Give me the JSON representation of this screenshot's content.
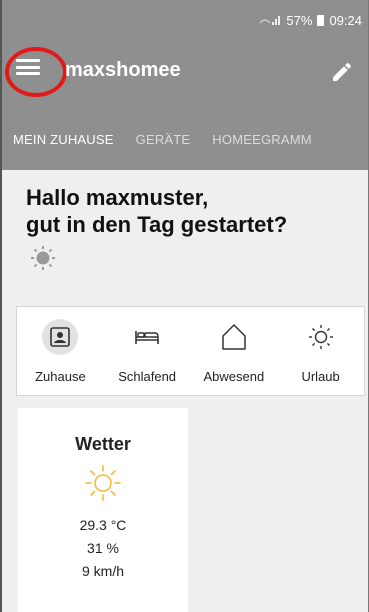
{
  "status_bar": {
    "signal_icons": "⚡ᵢₗ",
    "battery_percent": "57%",
    "time": "09:24"
  },
  "app_bar": {
    "title": "maxshomee",
    "menu_icon": "hamburger-menu-icon",
    "edit_icon": "pencil-icon"
  },
  "tabs": [
    {
      "label": "MEIN ZUHAUSE",
      "active": true
    },
    {
      "label": "GERÄTE",
      "active": false
    },
    {
      "label": "HOMEEGRAMM",
      "active": false
    }
  ],
  "greeting": {
    "line1": "Hallo maxmuster,",
    "line2": "gut in den Tag gestartet?"
  },
  "modes": [
    {
      "label": "Zuhause",
      "icon": "home-person-icon",
      "active": true
    },
    {
      "label": "Schlafend",
      "icon": "bed-icon",
      "active": false
    },
    {
      "label": "Abwesend",
      "icon": "house-outline-icon",
      "active": false
    },
    {
      "label": "Urlaub",
      "icon": "sun-outline-icon",
      "active": false
    }
  ],
  "weather": {
    "title": "Wetter",
    "temperature": "29.3 °C",
    "humidity": "31 %",
    "wind": "9 km/h",
    "icon": "sun-icon"
  },
  "colors": {
    "appbar": "#8f8f8f",
    "annotation_circle": "#e01a1a",
    "weather_sun": "#f6b93b"
  }
}
